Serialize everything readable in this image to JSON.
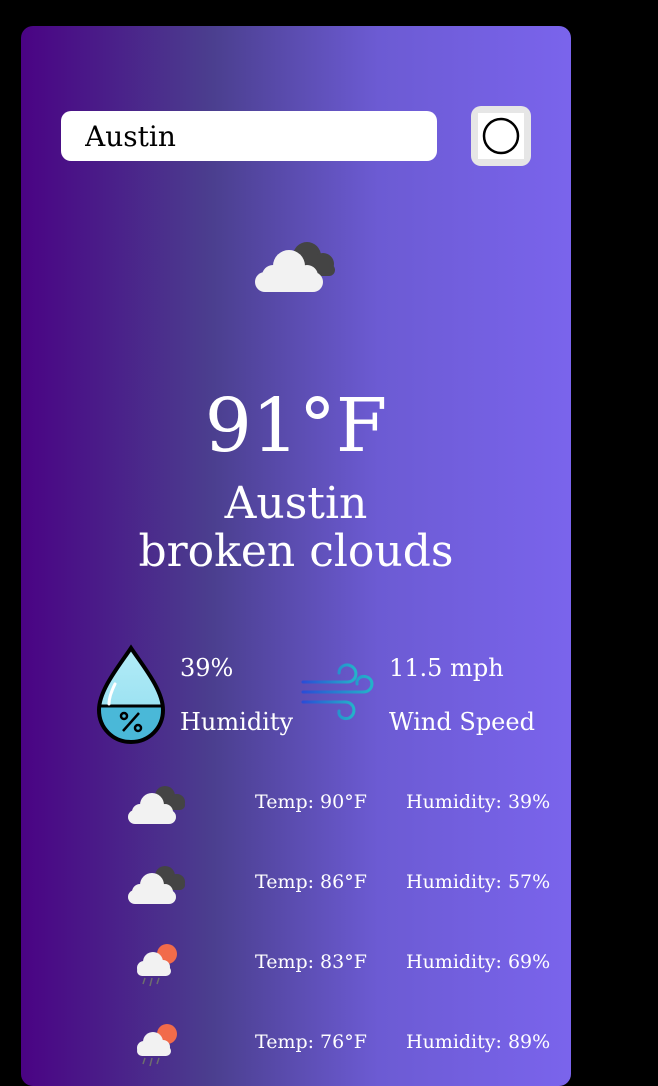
{
  "search": {
    "value": "Austin",
    "placeholder": ""
  },
  "search_button": {
    "icon": "search-icon"
  },
  "current": {
    "icon": "broken-clouds-icon",
    "temperature": "91°F",
    "city": "Austin",
    "description": "broken clouds"
  },
  "stats": {
    "humidity": {
      "value": "39%",
      "label": "Humidity",
      "icon": "humidity-drop-icon"
    },
    "wind": {
      "value": "11.5 mph",
      "label": "Wind Speed",
      "icon": "wind-icon"
    }
  },
  "forecast": [
    {
      "icon": "broken-clouds-icon",
      "temp": "Temp: 90°F",
      "humidity": "Humidity: 39%"
    },
    {
      "icon": "broken-clouds-icon",
      "temp": "Temp: 86°F",
      "humidity": "Humidity: 57%"
    },
    {
      "icon": "sun-rain-cloud-icon",
      "temp": "Temp: 83°F",
      "humidity": "Humidity: 69%"
    },
    {
      "icon": "sun-rain-cloud-icon",
      "temp": "Temp: 76°F",
      "humidity": "Humidity: 89%"
    }
  ],
  "colors": {
    "page_background": "#000000",
    "gradient_start": "#4a0384",
    "gradient_end": "#7a64ec",
    "text": "#ffffff"
  }
}
